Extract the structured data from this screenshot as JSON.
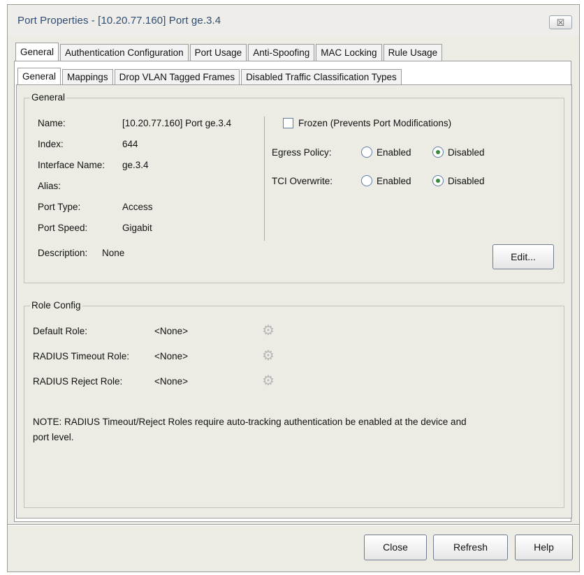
{
  "window": {
    "title": "Port Properties - [10.20.77.160] Port ge.3.4",
    "close_glyph": "☒"
  },
  "tabs": [
    {
      "label": "General",
      "active": true
    },
    {
      "label": "Authentication Configuration",
      "active": false
    },
    {
      "label": "Port Usage",
      "active": false
    },
    {
      "label": "Anti-Spoofing",
      "active": false
    },
    {
      "label": "MAC Locking",
      "active": false
    },
    {
      "label": "Rule Usage",
      "active": false
    }
  ],
  "subtabs": [
    {
      "label": "General",
      "active": true
    },
    {
      "label": "Mappings",
      "active": false
    },
    {
      "label": "Drop VLAN Tagged Frames",
      "active": false
    },
    {
      "label": "Disabled Traffic Classification Types",
      "active": false
    }
  ],
  "general": {
    "legend": "General",
    "fields": [
      {
        "label": "Name:",
        "value": "[10.20.77.160] Port ge.3.4"
      },
      {
        "label": "Index:",
        "value": "644"
      },
      {
        "label": "Interface Name:",
        "value": "ge.3.4"
      },
      {
        "label": "Alias:",
        "value": ""
      },
      {
        "label": "Port Type:",
        "value": "Access"
      },
      {
        "label": "Port Speed:",
        "value": "Gigabit"
      }
    ],
    "description_label": "Description:",
    "description_value": "None",
    "frozen_label": "Frozen (Prevents Port Modifications)",
    "frozen_checked": false,
    "egress_label": "Egress Policy:",
    "tci_label": "TCI Overwrite:",
    "enabled_label": "Enabled",
    "disabled_label": "Disabled",
    "egress_value": "Disabled",
    "tci_value": "Disabled",
    "edit_label": "Edit..."
  },
  "role_config": {
    "legend": "Role Config",
    "rows": [
      {
        "label": "Default Role:",
        "value": "<None>"
      },
      {
        "label": "RADIUS Timeout Role:",
        "value": "<None>"
      },
      {
        "label": "RADIUS Reject Role:",
        "value": "<None>"
      }
    ],
    "note_line1": "NOTE: RADIUS Timeout/Reject Roles require auto-tracking authentication be enabled at the device and",
    "note_line2": "port level."
  },
  "buttons": {
    "close": "Close",
    "refresh": "Refresh",
    "help": "Help"
  },
  "icons": {
    "gear": "⚙",
    "accent": "#2f4d72",
    "radio_selected": "#3a8a3a"
  }
}
